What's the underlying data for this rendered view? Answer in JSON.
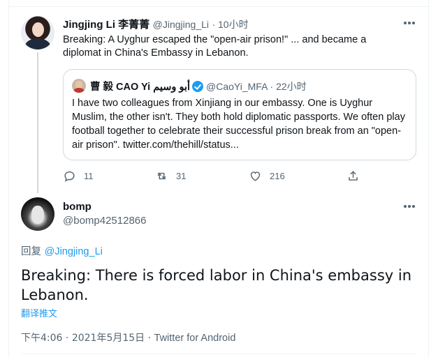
{
  "parent_tweet": {
    "name": "Jingjing Li 李菁菁",
    "handle": "@Jingjing_Li",
    "time": "10小时",
    "text": "Breaking: A Uyghur escaped the \"open-air prison!\" ... and became a diplomat in China's Embassy in Lebanon.",
    "quote": {
      "name": "曹 毅 CAO Yi أبو وسيم",
      "handle": "@CaoYi_MFA",
      "time": "22小时",
      "text": "I have two colleagues from Xinjiang in our embassy. One is Uyghur Muslim, the other isn't. They both hold diplomatic passports. We often play football together to celebrate their successful prison break from an \"open-air prison\". twitter.com/thehill/status..."
    },
    "actions": {
      "replies": "11",
      "retweets": "31",
      "likes": "216"
    }
  },
  "reply_tweet": {
    "name": "bomp",
    "handle": "@bomp42512866",
    "reply_prefix": "回复",
    "reply_to": "@Jingjing_Li",
    "text": "Breaking: There is forced labor in China's embassy in Lebanon.",
    "translate_label": "翻译推文",
    "time": "下午4:06",
    "date": "2021年5月15日",
    "source": "Twitter for Android"
  },
  "colors": {
    "accent": "#1d9bf0",
    "secondary_text": "#536471",
    "primary_text": "#0f1419",
    "divider": "#eff3f4"
  },
  "icons": [
    "more-icon",
    "verified-icon",
    "reply-icon",
    "retweet-icon",
    "like-icon",
    "share-icon"
  ]
}
